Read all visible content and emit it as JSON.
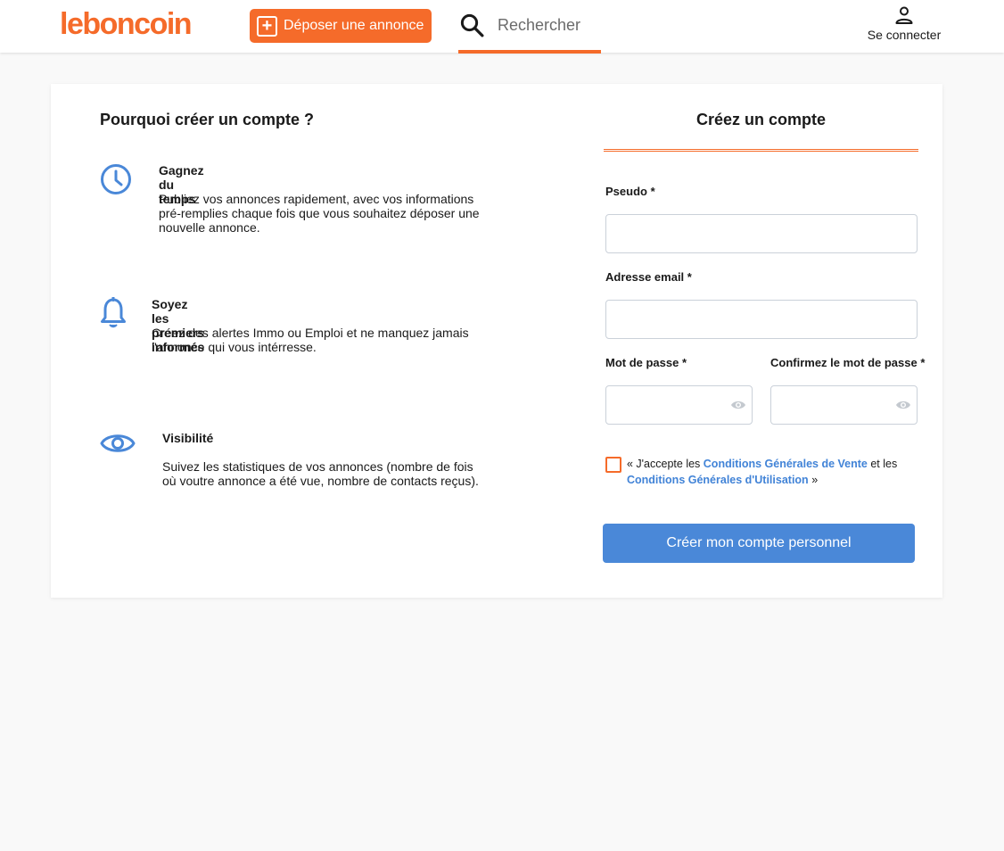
{
  "header": {
    "logo": "leboncoin",
    "post_button": "Déposer une annonce",
    "search_label": "Rechercher",
    "login_label": "Se connecter"
  },
  "why": {
    "title": "Pourquoi créer un compte ?",
    "features": [
      {
        "icon": "clock-icon",
        "title": "Gagnez du temps",
        "description": "Publiez vos annonces rapidement, avec vos informations pré-remplies chaque fois que vous souhaitez déposer une nouvelle annonce."
      },
      {
        "icon": "bell-icon",
        "title": "Soyez les premiers informés",
        "description": "Créez des alertes Immo ou Emploi et ne manquez jamais l'annonce qui vous intérresse."
      },
      {
        "icon": "eye-icon",
        "title": "Visibilité",
        "description": "Suivez les statistiques de vos annonces (nombre de fois où voutre annonce a été vue, nombre de contacts reçus)."
      }
    ]
  },
  "form": {
    "title": "Créez un compte",
    "pseudo_label": "Pseudo *",
    "pseudo_value": "",
    "email_label": "Adresse email *",
    "email_value": "",
    "password_label": "Mot de passe *",
    "password_value": "",
    "confirm_label": "Confirmez le mot de passe *",
    "confirm_value": "",
    "terms_prefix": "« J'accepte les",
    "terms_cgv": "Conditions Générales de Vente",
    "terms_mid": "et les",
    "terms_cgu": "Conditions Générales d'Utilisation",
    "terms_suffix": "»",
    "submit_label": "Créer mon compte personnel"
  },
  "colors": {
    "brand_orange": "#f56b2a",
    "accent_blue": "#4a88d8",
    "link_blue": "#4183d7"
  }
}
